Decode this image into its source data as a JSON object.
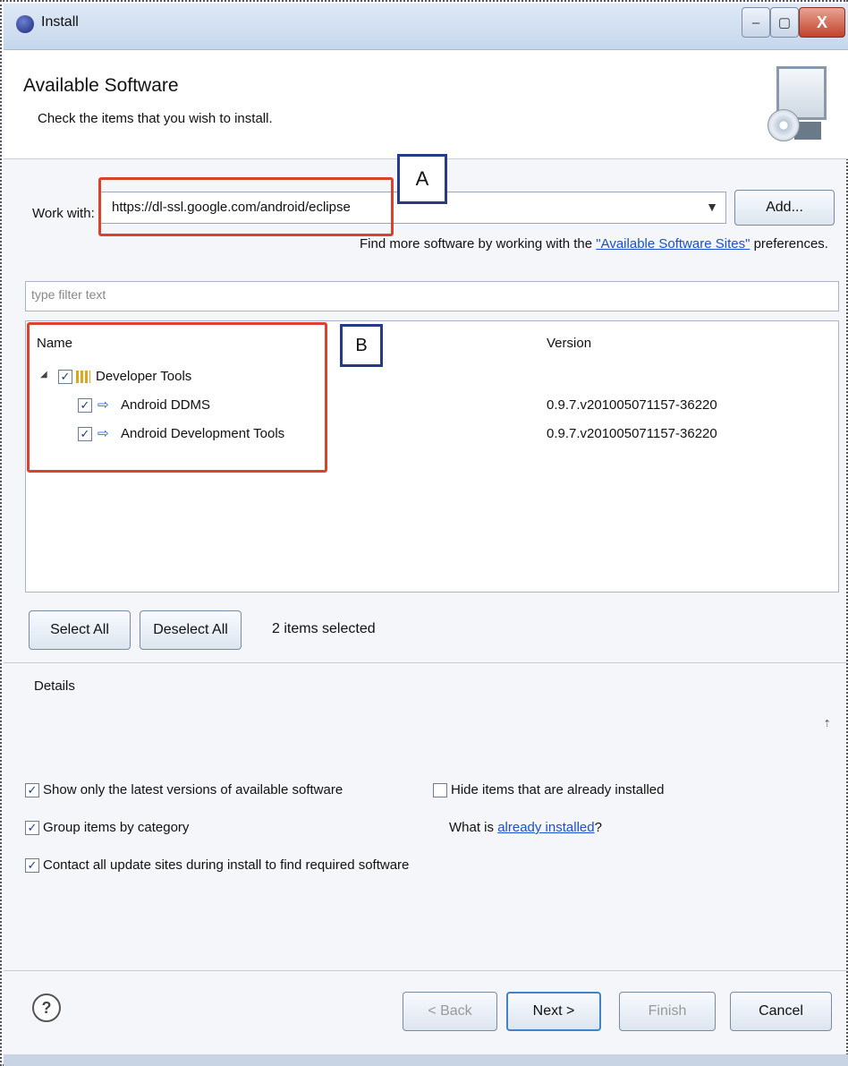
{
  "window": {
    "title": "Install",
    "minimize_glyph": "‒",
    "maximize_glyph": "▢",
    "close_glyph": "X"
  },
  "banner": {
    "title": "Available Software",
    "subtitle": "Check the items that you wish to install."
  },
  "work_with": {
    "label": "Work with:",
    "value": "https://dl-ssl.google.com/android/eclipse",
    "dropdown_glyph": "▼",
    "add_button": "Add...",
    "find_more_prefix": "Find more software by working with the ",
    "find_more_link": "\"Available Software Sites\"",
    "find_more_suffix": " preferences."
  },
  "annotations": {
    "callout_a": "A",
    "callout_b": "B"
  },
  "filter": {
    "placeholder": "type filter text"
  },
  "tree": {
    "columns": [
      "Name",
      "Version"
    ],
    "expander_glyph": "◢",
    "check_glyph": "✓",
    "feature_glyph": "⇨",
    "rows": [
      {
        "name": "Developer Tools",
        "version": "",
        "checked": true
      },
      {
        "name": "Android DDMS",
        "version": "0.9.7.v201005071157-36220",
        "checked": true
      },
      {
        "name": "Android Development Tools",
        "version": "0.9.7.v201005071157-36220",
        "checked": true
      }
    ]
  },
  "selection": {
    "select_all": "Select All",
    "deselect_all": "Deselect All",
    "status": "2 items selected"
  },
  "details": {
    "label": "Details",
    "scroll_glyph": "⇡"
  },
  "options": {
    "latest_versions": {
      "label": "Show only the latest versions of available software",
      "checked": true
    },
    "group_by_category": {
      "label": "Group items by category",
      "checked": true
    },
    "contact_sites": {
      "label": "Contact all update sites during install to find required software",
      "checked": true
    },
    "hide_installed": {
      "label": "Hide items that are already installed",
      "checked": false
    },
    "what_is_prefix": "What is ",
    "what_is_link": "already installed",
    "what_is_suffix": "?"
  },
  "footer": {
    "help_glyph": "?",
    "back": "< Back",
    "next": "Next >",
    "finish": "Finish",
    "cancel": "Cancel"
  }
}
